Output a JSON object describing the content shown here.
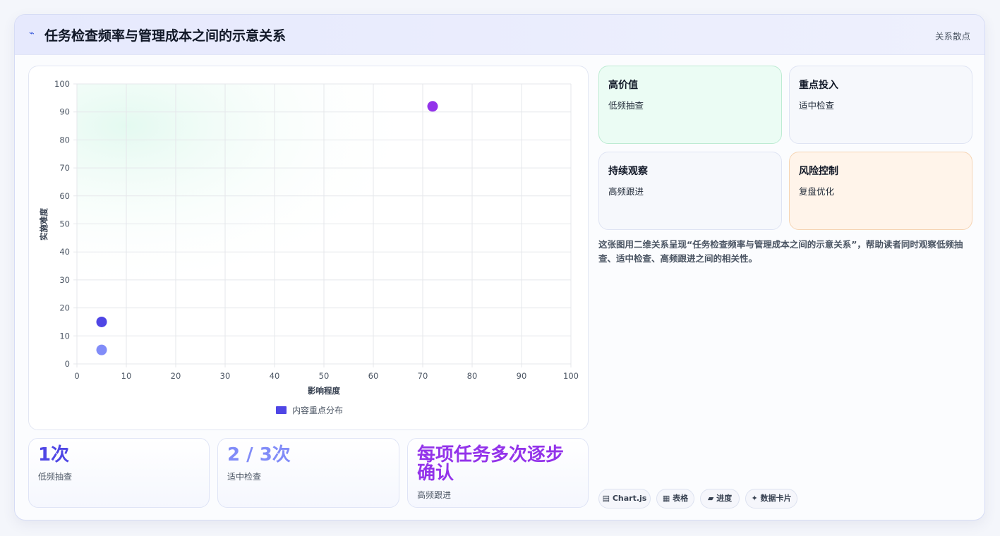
{
  "header": {
    "icon": "lightning-icon",
    "title": "任务检查频率与管理成本之间的示意关系",
    "tag": "关系散点"
  },
  "chart_data": {
    "type": "scatter",
    "title": "",
    "xlabel": "影响程度",
    "ylabel": "实施难度",
    "xlim": [
      0,
      100
    ],
    "ylim": [
      0,
      100
    ],
    "x_ticks": [
      "0",
      "10",
      "20",
      "30",
      "40",
      "50",
      "60",
      "70",
      "80",
      "90",
      "100"
    ],
    "y_ticks": [
      "0",
      "10",
      "20",
      "30",
      "40",
      "50",
      "60",
      "70",
      "80",
      "90",
      "100"
    ],
    "grid": true,
    "legend": {
      "label": "内容重点分布",
      "color": "#4f46e5",
      "placement": "bottom"
    },
    "points": [
      {
        "x": 5,
        "y": 15,
        "color": "#4f46e5"
      },
      {
        "x": 5,
        "y": 5,
        "color": "#818cf8"
      },
      {
        "x": 72,
        "y": 92,
        "color": "#9333ea"
      }
    ]
  },
  "stats": [
    {
      "value": "1次",
      "label": "低频抽查",
      "color": "#4f46e5"
    },
    {
      "value": "2 / 3次",
      "label": "适中检查",
      "color": "#818cf8"
    },
    {
      "value": "每项任务多次逐步确认",
      "label": "高频跟进",
      "color": "#9333ea"
    }
  ],
  "quadrants": [
    {
      "title": "高价值",
      "subtitle": "低频抽查",
      "bg": "#ebfcf4",
      "border": "#bdebd3"
    },
    {
      "title": "重点投入",
      "subtitle": "适中检查",
      "bg": "#f6f8fc",
      "border": "#dfe4f3"
    },
    {
      "title": "持续观察",
      "subtitle": "高频跟进",
      "bg": "#f6f8fc",
      "border": "#dfe4f3"
    },
    {
      "title": "风险控制",
      "subtitle": "复盘优化",
      "bg": "#fff4ea",
      "border": "#f6d5b5"
    }
  ],
  "description": "这张图用二维关系呈现“任务检查频率与管理成本之间的示意关系”，帮助读者同时观察低频抽查、适中检查、高频跟进之间的相关性。",
  "badges": [
    {
      "label": "▤ Chart.js",
      "icon": "chart-icon"
    },
    {
      "label": "▦ 表格",
      "icon": "table-icon"
    },
    {
      "label": "▰ 进度",
      "icon": "progress-icon"
    },
    {
      "label": "✦ 数据卡片",
      "icon": "card-icon"
    }
  ]
}
